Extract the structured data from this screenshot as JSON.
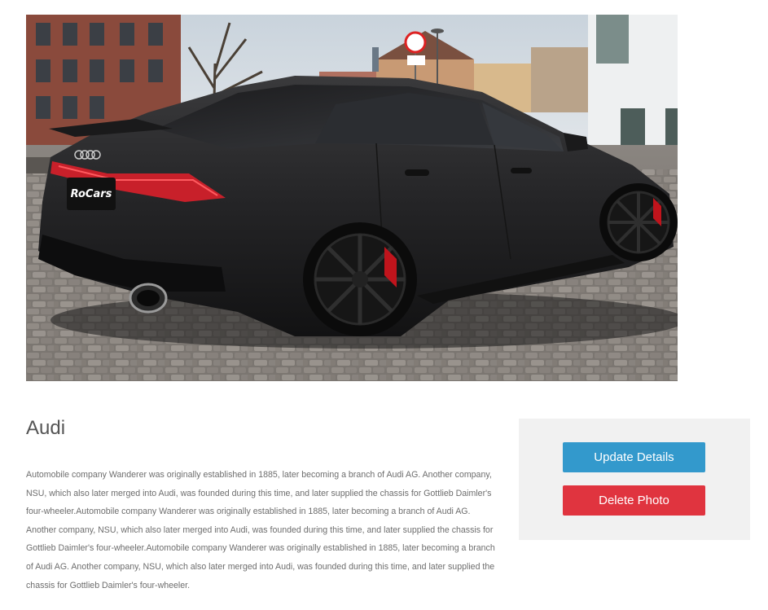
{
  "photo": {
    "alt": "Black Audi sportback parked on cobblestones",
    "plate_text": "RoCars"
  },
  "car": {
    "title": "Audi",
    "description": "Automobile company Wanderer was originally established in 1885, later becoming a branch of Audi AG. Another company, NSU, which also later merged into Audi, was founded during this time, and later supplied the chassis for Gottlieb Daimler's four-wheeler.Automobile company Wanderer was originally established in 1885, later becoming a branch of Audi AG. Another company, NSU, which also later merged into Audi, was founded during this time, and later supplied the chassis for Gottlieb Daimler's four-wheeler.Automobile company Wanderer was originally established in 1885, later becoming a branch of Audi AG. Another company, NSU, which also later merged into Audi, was founded during this time, and later supplied the chassis for Gottlieb Daimler's four-wheeler."
  },
  "actions": {
    "update_label": "Update Details",
    "delete_label": "Delete Photo"
  },
  "colors": {
    "update_button": "#3399cc",
    "delete_button": "#e0343f",
    "panel_background": "#f1f1f1",
    "title_text": "#555555",
    "body_text": "#6d6d6d"
  }
}
